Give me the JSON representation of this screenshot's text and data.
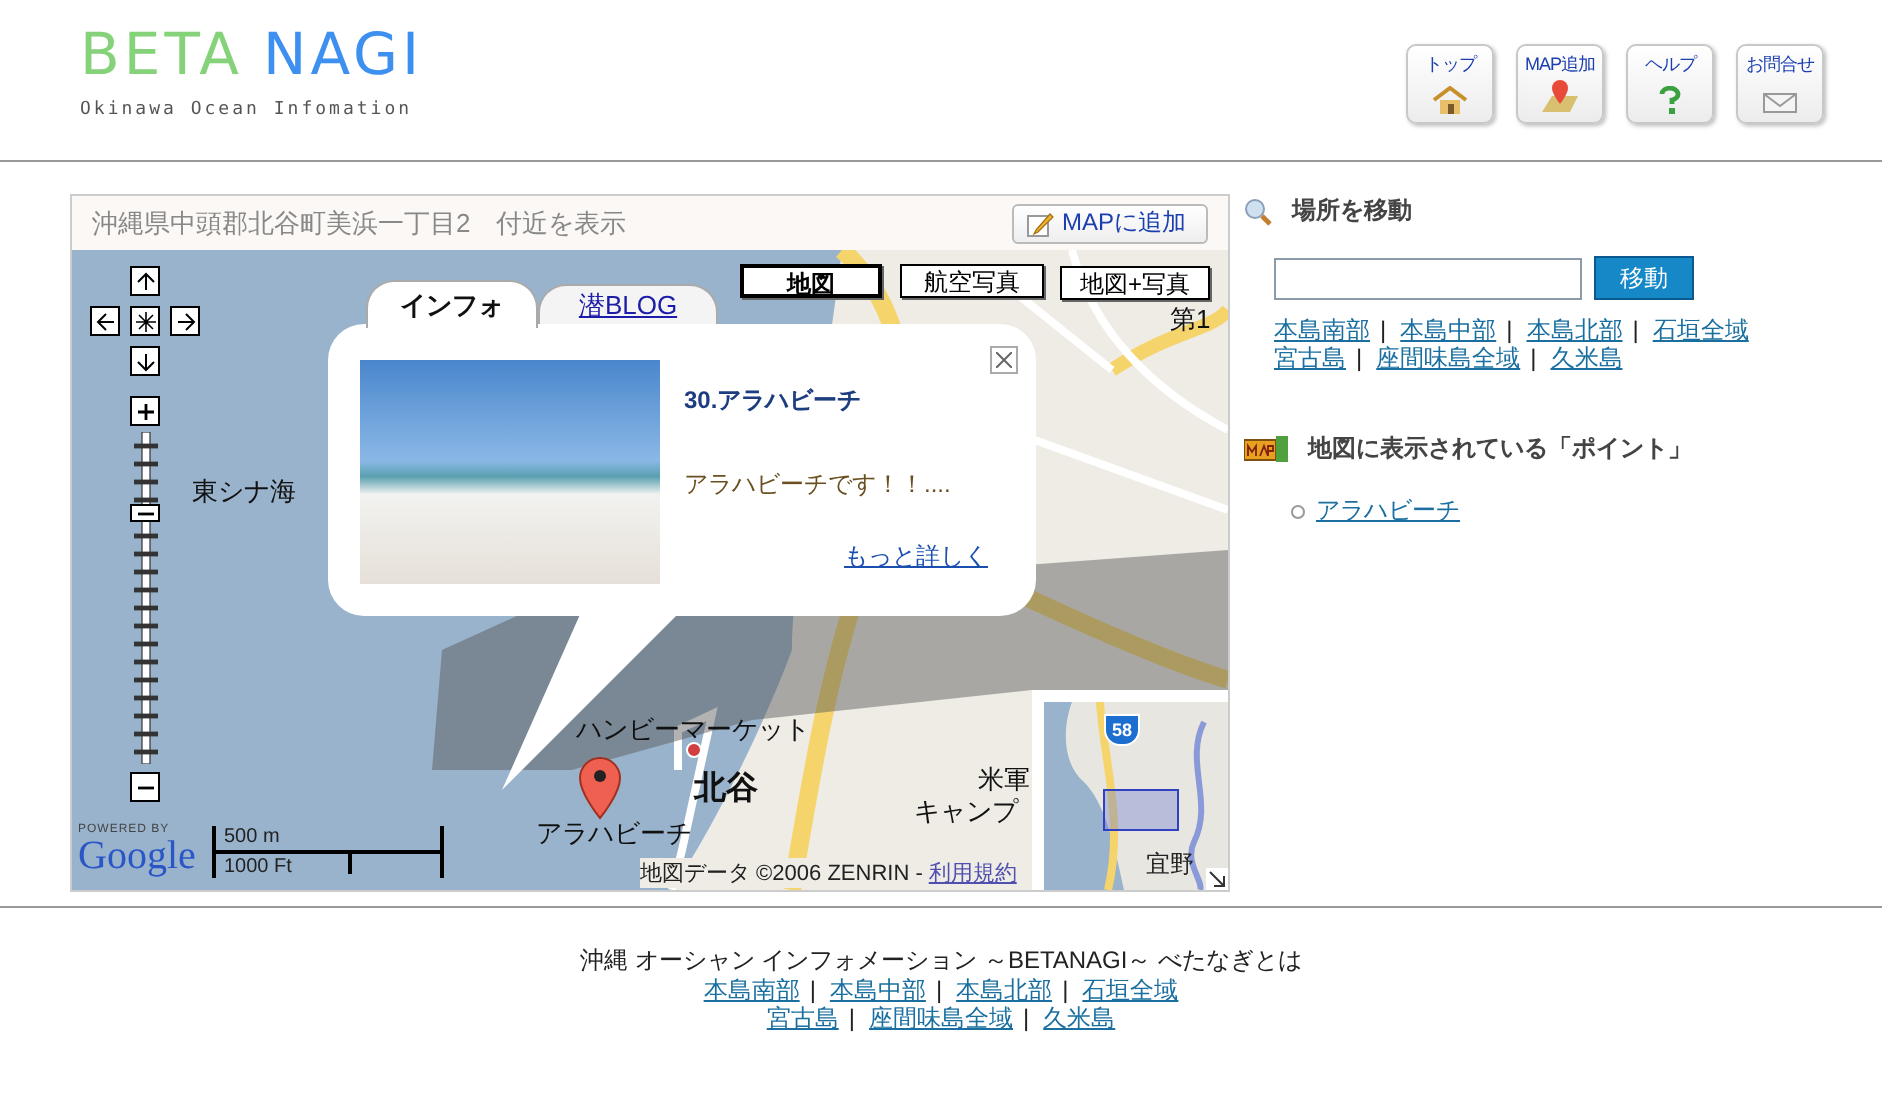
{
  "header": {
    "logo": {
      "words": [
        {
          "text": "BETA",
          "color": "#86d27a"
        },
        {
          "text": "NAGI",
          "color": "#3d8ff0"
        }
      ],
      "subtitle": "Okinawa Ocean Infomation"
    },
    "nav_buttons": [
      {
        "label": "トップ",
        "kind": "home"
      },
      {
        "label": "MAP追加",
        "kind": "pin"
      },
      {
        "label": "ヘルプ",
        "kind": "help"
      },
      {
        "label": "お問合せ",
        "kind": "mail"
      }
    ]
  },
  "map_panel": {
    "address": "沖縄県中頭郡北谷町美浜一丁目2　付近を表示",
    "add_button": "MAPに追加",
    "map_types": [
      {
        "label": "地図",
        "selected": true
      },
      {
        "label": "航空写真",
        "selected": false
      },
      {
        "label": "地図+写真",
        "selected": false
      }
    ],
    "labels": [
      {
        "text": "東シナ海",
        "kind": "place"
      },
      {
        "text": "第1",
        "kind": "place"
      },
      {
        "text": "ハンビーマーケット",
        "kind": "place"
      },
      {
        "text": "北谷",
        "kind": "area"
      },
      {
        "text": "米軍",
        "kind": "place"
      },
      {
        "text": "キャンプ",
        "kind": "place"
      },
      {
        "text": "アラハビーチ",
        "kind": "place"
      }
    ],
    "info_window": {
      "tabs": [
        {
          "label": "インフォ",
          "selected": true
        },
        {
          "label": "潜BLOG",
          "selected": false
        }
      ],
      "title": "30.アラハビーチ",
      "description": "アラハビーチです！！....",
      "more_link": "もっと詳しく"
    },
    "overview": {
      "route": "58",
      "label": "宜野"
    },
    "powered_by": "POWERED BY",
    "google_logo": "Google",
    "scale": {
      "metric": "500 m",
      "imperial": "1000 Ft"
    },
    "copyright": "地図データ ©2006 ZENRIN -",
    "terms_link": "利用規約"
  },
  "sidebar": {
    "move": {
      "heading": "場所を移動",
      "button": "移動",
      "link_rows": [
        [
          {
            "label": "本島南部",
            "separator": "|"
          },
          {
            "label": "本島中部",
            "separator": "|"
          },
          {
            "label": "本島北部",
            "separator": "|"
          },
          {
            "label": "石垣全域"
          }
        ],
        [
          {
            "label": "宮古島",
            "separator": "|"
          },
          {
            "label": "座間味島全域",
            "separator": "|"
          },
          {
            "label": "久米島"
          }
        ]
      ]
    },
    "points": {
      "heading": "地図に表示されている「ポイント」",
      "items": [
        {
          "label": "アラハビーチ"
        }
      ]
    }
  },
  "footer": {
    "title": "沖縄 オーシャン インフォメーション ～BETANAGI～ べたなぎとは",
    "link_rows": [
      [
        {
          "label": "本島南部",
          "separator": "|"
        },
        {
          "label": "本島中部",
          "separator": "|"
        },
        {
          "label": "本島北部",
          "separator": "|"
        },
        {
          "label": "石垣全域"
        }
      ],
      [
        {
          "label": "宮古島",
          "separator": "|"
        },
        {
          "label": "座間味島全域",
          "separator": "|"
        },
        {
          "label": "久米島"
        }
      ]
    ]
  }
}
